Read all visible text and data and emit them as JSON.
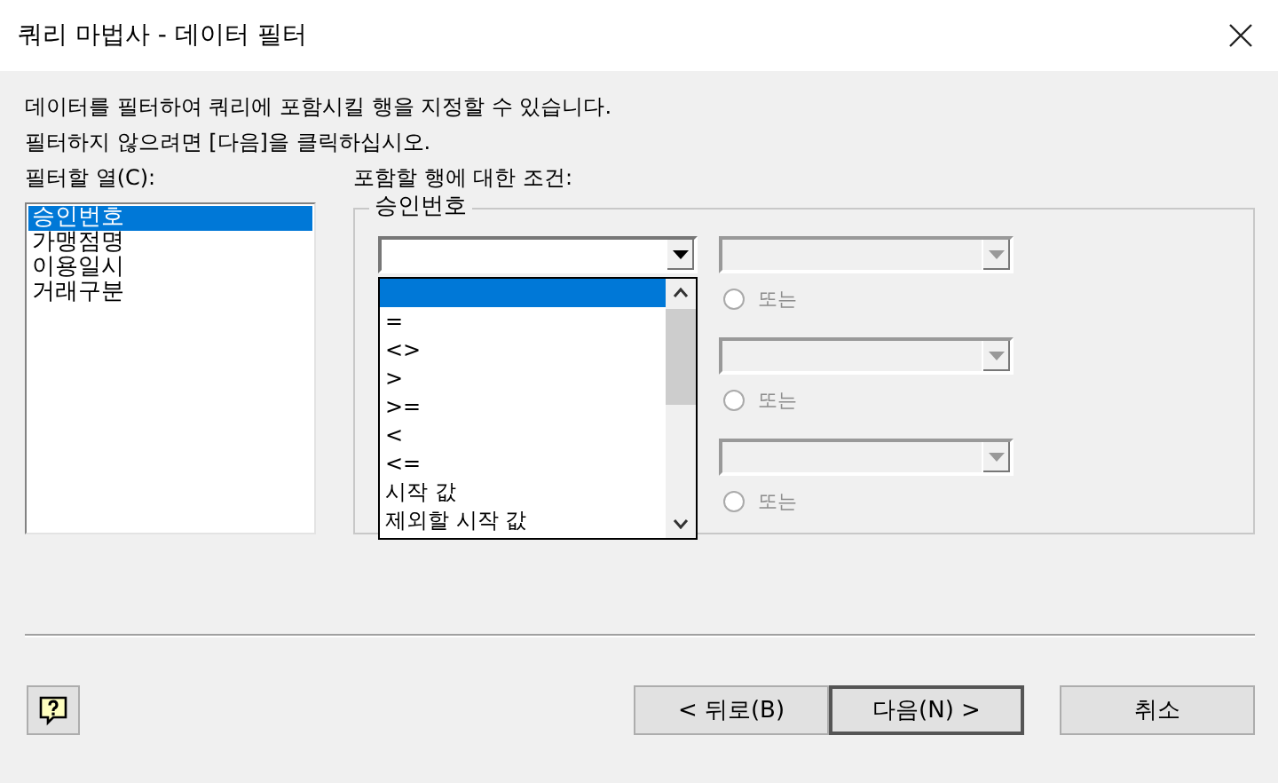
{
  "window": {
    "title": "쿼리 마법사 - 데이터 필터"
  },
  "instructions": [
    "데이터를 필터하여 쿼리에 포함시킬 행을 지정할 수 있습니다.",
    "필터하지 않으려면 [다음]을 클릭하십시오."
  ],
  "columns_label": "필터할 열(C):",
  "columns": [
    {
      "label": "승인번호",
      "selected": true
    },
    {
      "label": "가맹점명",
      "selected": false
    },
    {
      "label": "이용일시",
      "selected": false
    },
    {
      "label": "거래구분",
      "selected": false
    }
  ],
  "conditions_label": "포함할 행에 대한 조건:",
  "group_title": "승인번호",
  "operator_dropdown": {
    "blank_selected": true,
    "options": [
      "=",
      "<>",
      ">",
      ">=",
      "<",
      "<=",
      "시작 값",
      "제외할 시작 값"
    ]
  },
  "value_conditions": [
    {
      "disabled": true,
      "or_label": "또는",
      "or_selected": false
    },
    {
      "disabled": true,
      "or_label": "또는",
      "or_selected": false
    },
    {
      "disabled": true,
      "or_label": "또는",
      "or_selected": false
    }
  ],
  "buttons": [
    {
      "kind": "help"
    },
    {
      "kind": "text",
      "label": "< 뒤로(B)",
      "default": false
    },
    {
      "kind": "text",
      "label": "다음(N) >",
      "default": true
    },
    {
      "kind": "gap"
    },
    {
      "kind": "text",
      "label": "취소",
      "default": false
    }
  ]
}
